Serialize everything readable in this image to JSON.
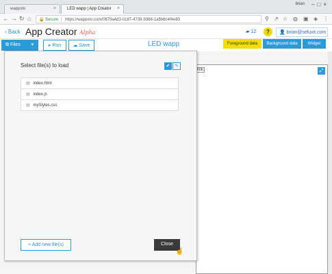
{
  "browser": {
    "tabs": [
      {
        "label": "wappsto"
      },
      {
        "label": "LED wapp | App Creator"
      }
    ],
    "profile_label": "brian",
    "address": {
      "secure_label": "Secure",
      "url": "https://wappsto.com/0679a4d3-0187-4739-9368-1a5b6c4f4e80"
    }
  },
  "app_header": {
    "back_label": "Back",
    "title": "App Creator",
    "badge": "Alpha",
    "notification_count": "12",
    "help_label": "?",
    "user_email": "brian@seluxit.com"
  },
  "toolbar": {
    "files_label": "Files",
    "run_label": "Run",
    "save_label": "Save",
    "doc_title": "LED wapp",
    "foreground_label": "Foreground data",
    "background_label": "Background data",
    "widget_label": "Widget"
  },
  "canvas": {
    "fragment_text": "link"
  },
  "modal": {
    "title": "Select file(s) to load",
    "files": [
      {
        "name": "index.html"
      },
      {
        "name": "index.js"
      },
      {
        "name": "myStyles.css"
      }
    ],
    "add_label": "+ Add new file(s)",
    "close_label": "Close"
  },
  "colors": {
    "accent": "#2a9bd8",
    "foreground_button": "#f2de00",
    "close_button": "#3a3a3a"
  }
}
